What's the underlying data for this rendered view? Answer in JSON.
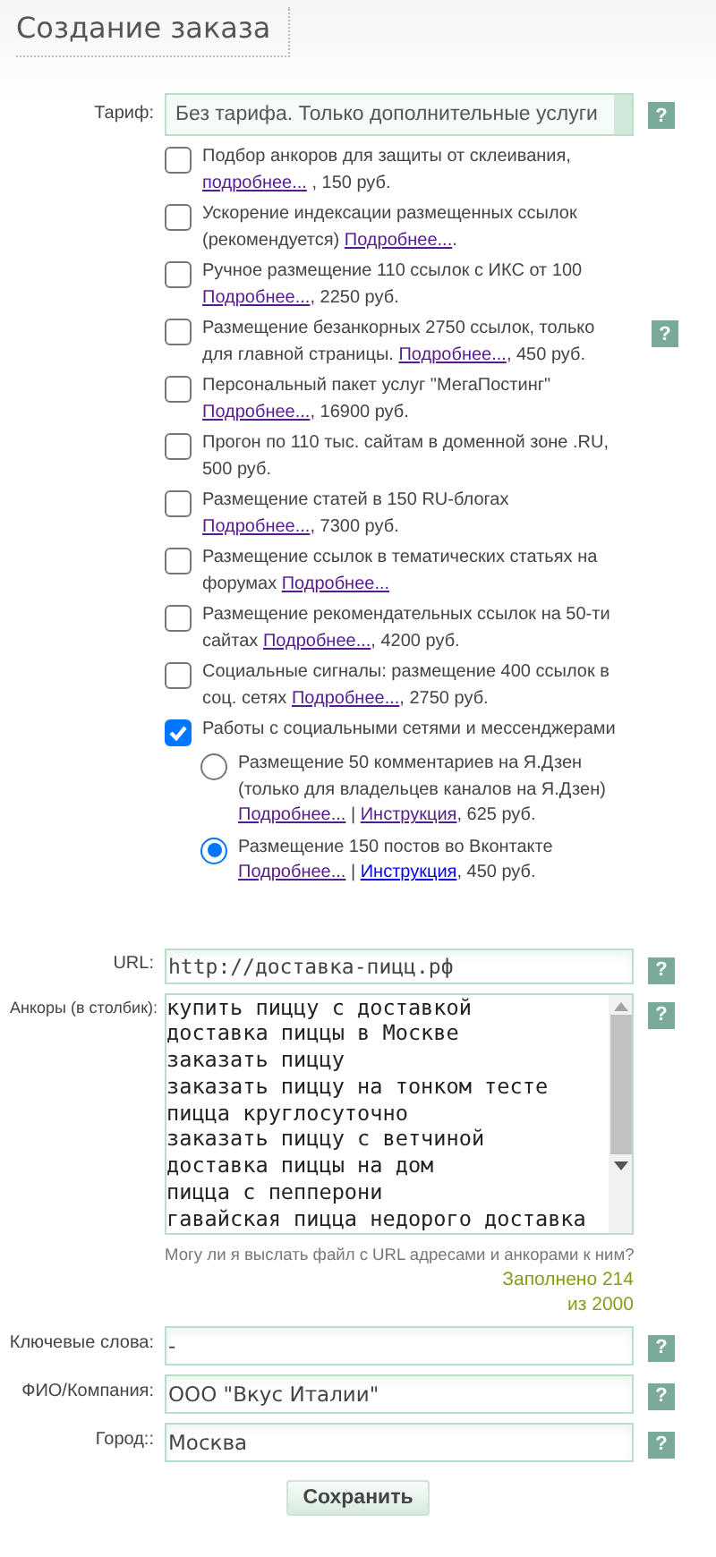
{
  "title": "Создание заказа",
  "tariff": {
    "label": "Тариф:",
    "value": "Без тарифа. Только дополнительные услуги",
    "help": "?"
  },
  "options": [
    {
      "kind": "checkbox",
      "checked": false,
      "parts": [
        {
          "kind": "text",
          "text": "Подбор анкоров для защиты от склеивания, "
        },
        {
          "kind": "link",
          "text": "подробнее...",
          "visited": true
        },
        {
          "kind": "text",
          "text": " , 150 руб."
        }
      ]
    },
    {
      "kind": "checkbox",
      "checked": false,
      "parts": [
        {
          "kind": "text",
          "text": "Ускорение индексации размещенных ссылок (рекомендуется) "
        },
        {
          "kind": "link",
          "text": "Подробнее...",
          "visited": true
        },
        {
          "kind": "text",
          "text": "."
        }
      ]
    },
    {
      "kind": "checkbox",
      "checked": false,
      "parts": [
        {
          "kind": "text",
          "text": "Ручное размещение 110 ссылок с ИКС от 100 "
        },
        {
          "kind": "link",
          "text": "Подробнее...",
          "visited": true
        },
        {
          "kind": "text",
          "text": ", 2250 руб."
        }
      ]
    },
    {
      "kind": "checkbox",
      "checked": false,
      "help": "?",
      "parts": [
        {
          "kind": "text",
          "text": "Размещение безанкорных 2750 ссылок, только для главной страницы. "
        },
        {
          "kind": "link",
          "text": "Подробнее...",
          "visited": true
        },
        {
          "kind": "text",
          "text": ", 450 руб."
        }
      ]
    },
    {
      "kind": "checkbox",
      "checked": false,
      "parts": [
        {
          "kind": "text",
          "text": "Персональный пакет услуг \"МегаПостинг\" "
        },
        {
          "kind": "link",
          "text": "Подробнее...",
          "visited": true
        },
        {
          "kind": "text",
          "text": ", 16900 руб."
        }
      ]
    },
    {
      "kind": "checkbox",
      "checked": false,
      "parts": [
        {
          "kind": "text",
          "text": "Прогон по 110 тыс. сайтам в доменной зоне .RU, 500 руб."
        }
      ]
    },
    {
      "kind": "checkbox",
      "checked": false,
      "parts": [
        {
          "kind": "text",
          "text": "Размещение статей в 150 RU-блогах "
        },
        {
          "kind": "link",
          "text": "Подробнее...",
          "visited": true
        },
        {
          "kind": "text",
          "text": ", 7300 руб."
        }
      ]
    },
    {
      "kind": "checkbox",
      "checked": false,
      "parts": [
        {
          "kind": "text",
          "text": "Размещение ссылок в тематических статьях на форумах "
        },
        {
          "kind": "link",
          "text": "Подробнее...",
          "visited": true
        }
      ]
    },
    {
      "kind": "checkbox",
      "checked": false,
      "parts": [
        {
          "kind": "text",
          "text": "Размещение рекомендательных ссылок на 50-ти сайтах "
        },
        {
          "kind": "link",
          "text": "Подробнее...",
          "visited": true
        },
        {
          "kind": "text",
          "text": ", 4200 руб."
        }
      ]
    },
    {
      "kind": "checkbox",
      "checked": false,
      "parts": [
        {
          "kind": "text",
          "text": "Социальные сигналы: размещение 400 ссылок в соц. сетях "
        },
        {
          "kind": "link",
          "text": "Подробнее...",
          "visited": true
        },
        {
          "kind": "text",
          "text": ", 2750 руб."
        }
      ]
    },
    {
      "kind": "checkbox",
      "checked": true,
      "parts": [
        {
          "kind": "text",
          "text": "Работы с социальными сетями и мессенджерами"
        }
      ]
    },
    {
      "kind": "radio",
      "selected": false,
      "parts": [
        {
          "kind": "text",
          "text": "Размещение 50 комментариев на Я.Дзен (только для владельцев каналов на Я.Дзен) "
        },
        {
          "kind": "link",
          "text": "Подробнее...",
          "visited": true
        },
        {
          "kind": "text",
          "text": " | "
        },
        {
          "kind": "link",
          "text": "Инструкция",
          "visited": true
        },
        {
          "kind": "text",
          "text": ", 625 руб."
        }
      ]
    },
    {
      "kind": "radio",
      "selected": true,
      "parts": [
        {
          "kind": "text",
          "text": "Размещение 150 постов во Вконтакте "
        },
        {
          "kind": "link",
          "text": "Подробнее...",
          "visited": true
        },
        {
          "kind": "text",
          "text": " | "
        },
        {
          "kind": "link",
          "text": "Инструкция",
          "visited": false
        },
        {
          "kind": "text",
          "text": ", 450 руб."
        }
      ]
    }
  ],
  "url": {
    "label": "URL:",
    "value": "http://доставка-пицц.рф",
    "help": "?"
  },
  "anchors": {
    "label": "Анкоры (в столбик):",
    "value": "купить пиццу с доставкой\nдоставка пиццы в Москве\nзаказать пиццу\nзаказать пиццу на тонком тесте\nпицца круглосуточно\nзаказать пиццу с ветчиной\nдоставка пиццы на дом\nпицца с пепперони\nгавайская пицца недорого доставка",
    "help": "?",
    "note": "Могу ли я выслать файл с URL адресами и анкорами к ним?",
    "counter": "Заполнено 214 из 2000"
  },
  "fields": [
    {
      "label": "Ключевые слова:",
      "value": "-",
      "help": "?"
    },
    {
      "label": "ФИО/Компания:",
      "value": "ООО \"Вкус Италии\"",
      "help": "?"
    },
    {
      "label": "Город::",
      "value": "Москва",
      "help": "?"
    }
  ],
  "save_button": "Сохранить"
}
